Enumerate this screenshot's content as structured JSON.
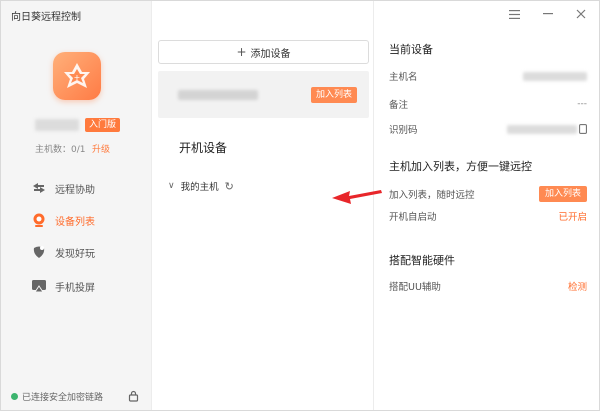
{
  "app": {
    "title": "向日葵远程控制"
  },
  "profile": {
    "edition_badge": "入门版",
    "host_count": "主机数：0/1",
    "upgrade": "升级"
  },
  "nav": [
    {
      "label": "远程协助",
      "icon": "remote-assist-icon"
    },
    {
      "label": "设备列表",
      "icon": "device-list-icon",
      "active": true
    },
    {
      "label": "发现好玩",
      "icon": "discover-icon"
    },
    {
      "label": "手机投屏",
      "icon": "screen-cast-icon"
    }
  ],
  "status": {
    "text": "已连接安全加密链路"
  },
  "middle": {
    "add_device": "添加设备",
    "device_card": {
      "action": "加入列表"
    },
    "section_title": "开机设备",
    "my_host": "我的主机"
  },
  "right": {
    "current_device": {
      "title": "当前设备",
      "host_name_label": "主机名",
      "note_label": "备注",
      "note_value": "---",
      "id_label": "识别码"
    },
    "join_list": {
      "title": "主机加入列表，方便一键远控",
      "add_label": "加入列表，随时远控",
      "add_button": "加入列表",
      "autostart_label": "开机自启动",
      "autostart_value": "已开启"
    },
    "hardware": {
      "title": "搭配智能硬件",
      "uu_label": "搭配UU辅助",
      "uu_action": "检测"
    }
  },
  "colors": {
    "accent": "#ff6b2b",
    "button": "#ff8a52",
    "status_ok": "#3cb46e",
    "arrow": "#e8262a"
  }
}
